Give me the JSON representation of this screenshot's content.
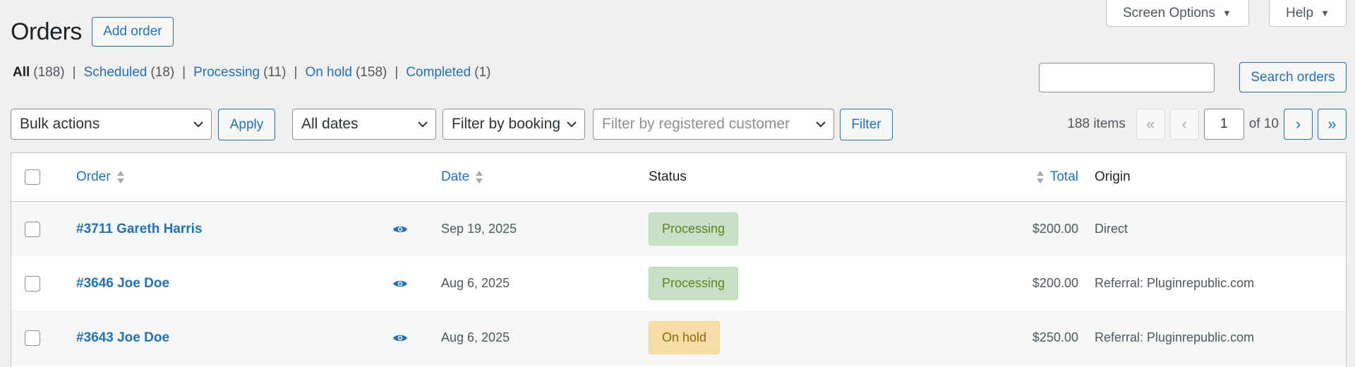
{
  "screen_tabs": {
    "screen_options": "Screen Options",
    "help": "Help"
  },
  "page": {
    "title": "Orders",
    "add_button": "Add order"
  },
  "status_filters": [
    {
      "label": "All",
      "count": "(188)"
    },
    {
      "label": "Scheduled",
      "count": "(18)"
    },
    {
      "label": "Processing",
      "count": "(11)"
    },
    {
      "label": "On hold",
      "count": "(158)"
    },
    {
      "label": "Completed",
      "count": "(1)"
    }
  ],
  "search": {
    "value": "",
    "button": "Search orders"
  },
  "tablenav": {
    "bulk_actions": "Bulk actions",
    "apply": "Apply",
    "dates": "All dates",
    "booking": "Filter by booking",
    "customer_placeholder": "Filter by registered customer",
    "filter": "Filter"
  },
  "pagination": {
    "items": "188 items",
    "first": "«",
    "prev": "‹",
    "current": "1",
    "of": "of 10",
    "next": "›",
    "last": "»"
  },
  "table": {
    "headers": {
      "order": "Order",
      "date": "Date",
      "status": "Status",
      "total": "Total",
      "origin": "Origin"
    },
    "rows": [
      {
        "order": "#3711 Gareth Harris",
        "date": "Sep 19, 2025",
        "status": "Processing",
        "total": "$200.00",
        "origin": "Direct"
      },
      {
        "order": "#3646 Joe Doe",
        "date": "Aug 6, 2025",
        "status": "Processing",
        "total": "$200.00",
        "origin": "Referral: Pluginrepublic.com"
      },
      {
        "order": "#3643 Joe Doe",
        "date": "Aug 6, 2025",
        "status": "On hold",
        "total": "$250.00",
        "origin": "Referral: Pluginrepublic.com"
      }
    ]
  },
  "colors": {
    "link": "#2271b1",
    "processing_bg": "#c6e1c6",
    "processing_text": "#5b841b",
    "onhold_bg": "#f8dda7",
    "onhold_text": "#94660c"
  }
}
